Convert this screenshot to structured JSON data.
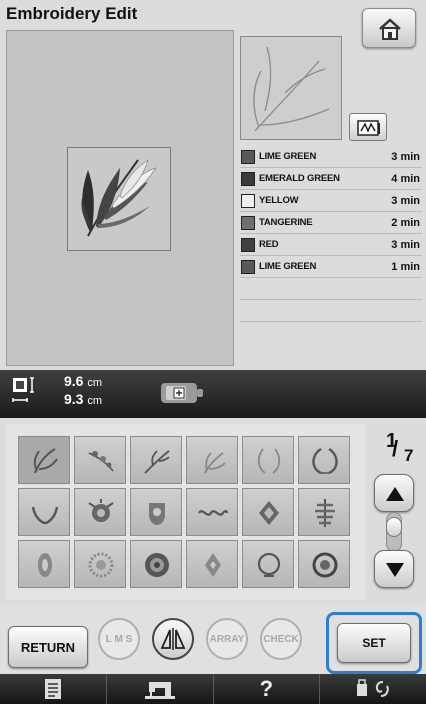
{
  "header": {
    "title": "Embroidery Edit"
  },
  "colors": [
    {
      "name": "LIME GREEN",
      "time": "3 min",
      "swatch": "#5a5a5a"
    },
    {
      "name": "EMERALD GREEN",
      "time": "4 min",
      "swatch": "#3a3a3a"
    },
    {
      "name": "YELLOW",
      "time": "3 min",
      "swatch": "#efefef"
    },
    {
      "name": "TANGERINE",
      "time": "2 min",
      "swatch": "#6e6e6e"
    },
    {
      "name": "RED",
      "time": "3 min",
      "swatch": "#3f3f3f"
    },
    {
      "name": "LIME GREEN",
      "time": "1 min",
      "swatch": "#5a5a5a"
    }
  ],
  "size": {
    "width_value": "9.6",
    "height_value": "9.3",
    "unit": "cm"
  },
  "pagination": {
    "current": "1",
    "total": "7"
  },
  "bottom": {
    "return_label": "RETURN",
    "lms_label": "L M S",
    "array_label": "ARRAY",
    "check_label": "CHECK",
    "set_label": "SET"
  },
  "footer": {
    "help_label": "?"
  },
  "accent": "#2f7fd0"
}
